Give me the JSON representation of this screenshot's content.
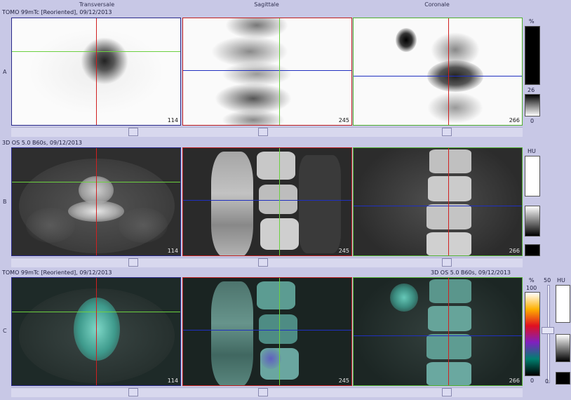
{
  "columns": {
    "transverse": "Transversale",
    "sagittal": "Sagittale",
    "coronal": "Coronale"
  },
  "rows": {
    "a": {
      "label": "A",
      "info": "TOMO 99mTc [Reoriented], 09/12/2013",
      "slices": {
        "transverse": "114",
        "sagittal": "245",
        "coronal": "266"
      }
    },
    "b": {
      "label": "B",
      "info": "3D OS 5.0 B60s, 09/12/2013",
      "slices": {
        "transverse": "114",
        "sagittal": "245",
        "coronal": "266"
      }
    },
    "c": {
      "label": "C",
      "info_left": "TOMO 99mTc [Reoriented], 09/12/2013",
      "info_right": "3D OS 5.0 B60s, 09/12/2013",
      "slices": {
        "transverse": "114",
        "sagittal": "245",
        "coronal": "266"
      }
    }
  },
  "colorbars": {
    "a": {
      "unit": "%",
      "max": "26",
      "min": "0"
    },
    "b": {
      "unit": "HU"
    },
    "c": {
      "unit": "%",
      "max": "100",
      "min": "0",
      "fusion_value": "50",
      "fusion_min": "0",
      "ct_unit": "HU"
    }
  },
  "colors": {
    "background": "#c8c8e6",
    "transverse_frame": "#2a2a8a",
    "sagittal_frame": "#c02020",
    "coronal_frame": "#50b030",
    "crosshair_green": "#6cd040",
    "crosshair_red": "#d02020",
    "crosshair_blue": "#2030c0"
  }
}
